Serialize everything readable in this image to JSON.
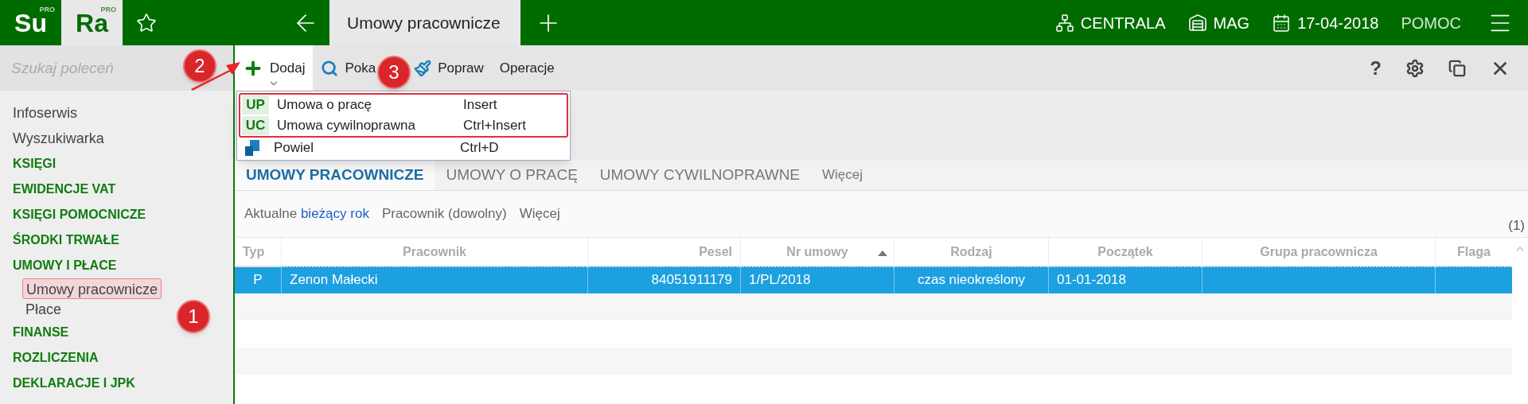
{
  "topbar": {
    "logos": [
      {
        "text": "Su",
        "sup": "PRO",
        "selected": false
      },
      {
        "text": "Ra",
        "sup": "PRO",
        "selected": true
      }
    ],
    "tab": "Umowy pracownicze",
    "items": [
      {
        "kind": "org",
        "label": "CENTRALA"
      },
      {
        "kind": "warehouse",
        "label": "MAG"
      },
      {
        "kind": "calendar",
        "label": "17-04-2018"
      },
      {
        "kind": "text",
        "label": "POMOC"
      }
    ]
  },
  "sidebar": {
    "search": {
      "placeholder": "Szukaj poleceń"
    },
    "items": [
      {
        "kind": "link",
        "label": "Infoserwis"
      },
      {
        "kind": "link",
        "label": "Wyszukiwarka"
      },
      {
        "kind": "section",
        "label": "KSIĘGI"
      },
      {
        "kind": "section",
        "label": "EWIDENCJE VAT"
      },
      {
        "kind": "section",
        "label": "KSIĘGI POMOCNICZE"
      },
      {
        "kind": "section",
        "label": "ŚRODKI TRWAŁE"
      },
      {
        "kind": "section",
        "label": "UMOWY I PŁACE",
        "children": [
          {
            "label": "Umowy pracownicze",
            "selected": true
          },
          {
            "label": "Płace",
            "selected": false
          }
        ]
      },
      {
        "kind": "section",
        "label": "FINANSE"
      },
      {
        "kind": "section",
        "label": "ROZLICZENIA"
      },
      {
        "kind": "section",
        "label": "DEKLARACJE I JPK"
      }
    ]
  },
  "toolbar": {
    "buttons": [
      {
        "kind": "add",
        "label": "Dodaj",
        "selected": true
      },
      {
        "kind": "search",
        "label": "Poka",
        "selected": false
      },
      {
        "kind": "brush",
        "label": "Popraw",
        "selected": false
      },
      {
        "kind": "text",
        "label": "Operacje",
        "selected": false
      }
    ],
    "right": [
      "?"
    ]
  },
  "dropdown": {
    "frame": true,
    "items": [
      {
        "kind": "badge",
        "badge": "UP",
        "label": "Umowa o pracę",
        "shortcut": "Insert"
      },
      {
        "kind": "badge",
        "badge": "UC",
        "label": "Umowa cywilnoprawna",
        "shortcut": "Ctrl+Insert"
      },
      {
        "kind": "icon",
        "label": "Powiel",
        "shortcut": "Ctrl+D"
      }
    ]
  },
  "tabs": [
    {
      "label": "UMOWY PRACOWNICZE",
      "selected": true
    },
    {
      "label": "UMOWY O PRACĘ",
      "selected": false
    },
    {
      "label": "UMOWY CYWILNOPRAWNE",
      "selected": false
    },
    {
      "label": "Więcej",
      "selected": false
    }
  ],
  "filters": [
    {
      "label": "Aktualne",
      "value": "bieżący rok"
    },
    {
      "label": "Pracownik (dowolny)"
    },
    {
      "label": "Więcej"
    }
  ],
  "count": "(1)",
  "table": {
    "columns": [
      {
        "label": "Typ",
        "sorted": false
      },
      {
        "label": "Pracownik",
        "sorted": false
      },
      {
        "label": "Pesel",
        "sorted": false
      },
      {
        "label": "Nr umowy",
        "sorted": true
      },
      {
        "label": "Rodzaj",
        "sorted": false
      },
      {
        "label": "Początek",
        "sorted": false
      },
      {
        "label": "Grupa pracownicza",
        "sorted": false
      },
      {
        "label": "Flaga",
        "sorted": false
      }
    ],
    "rows": [
      {
        "selected": true,
        "cells": [
          "P",
          "Zenon Małecki",
          "84051911179",
          "1/PL/2018",
          "czas nieokreślony",
          "01-01-2018",
          "",
          ""
        ]
      }
    ]
  },
  "annotations": [
    {
      "number": "1"
    },
    {
      "number": "2"
    },
    {
      "number": "3"
    }
  ]
}
